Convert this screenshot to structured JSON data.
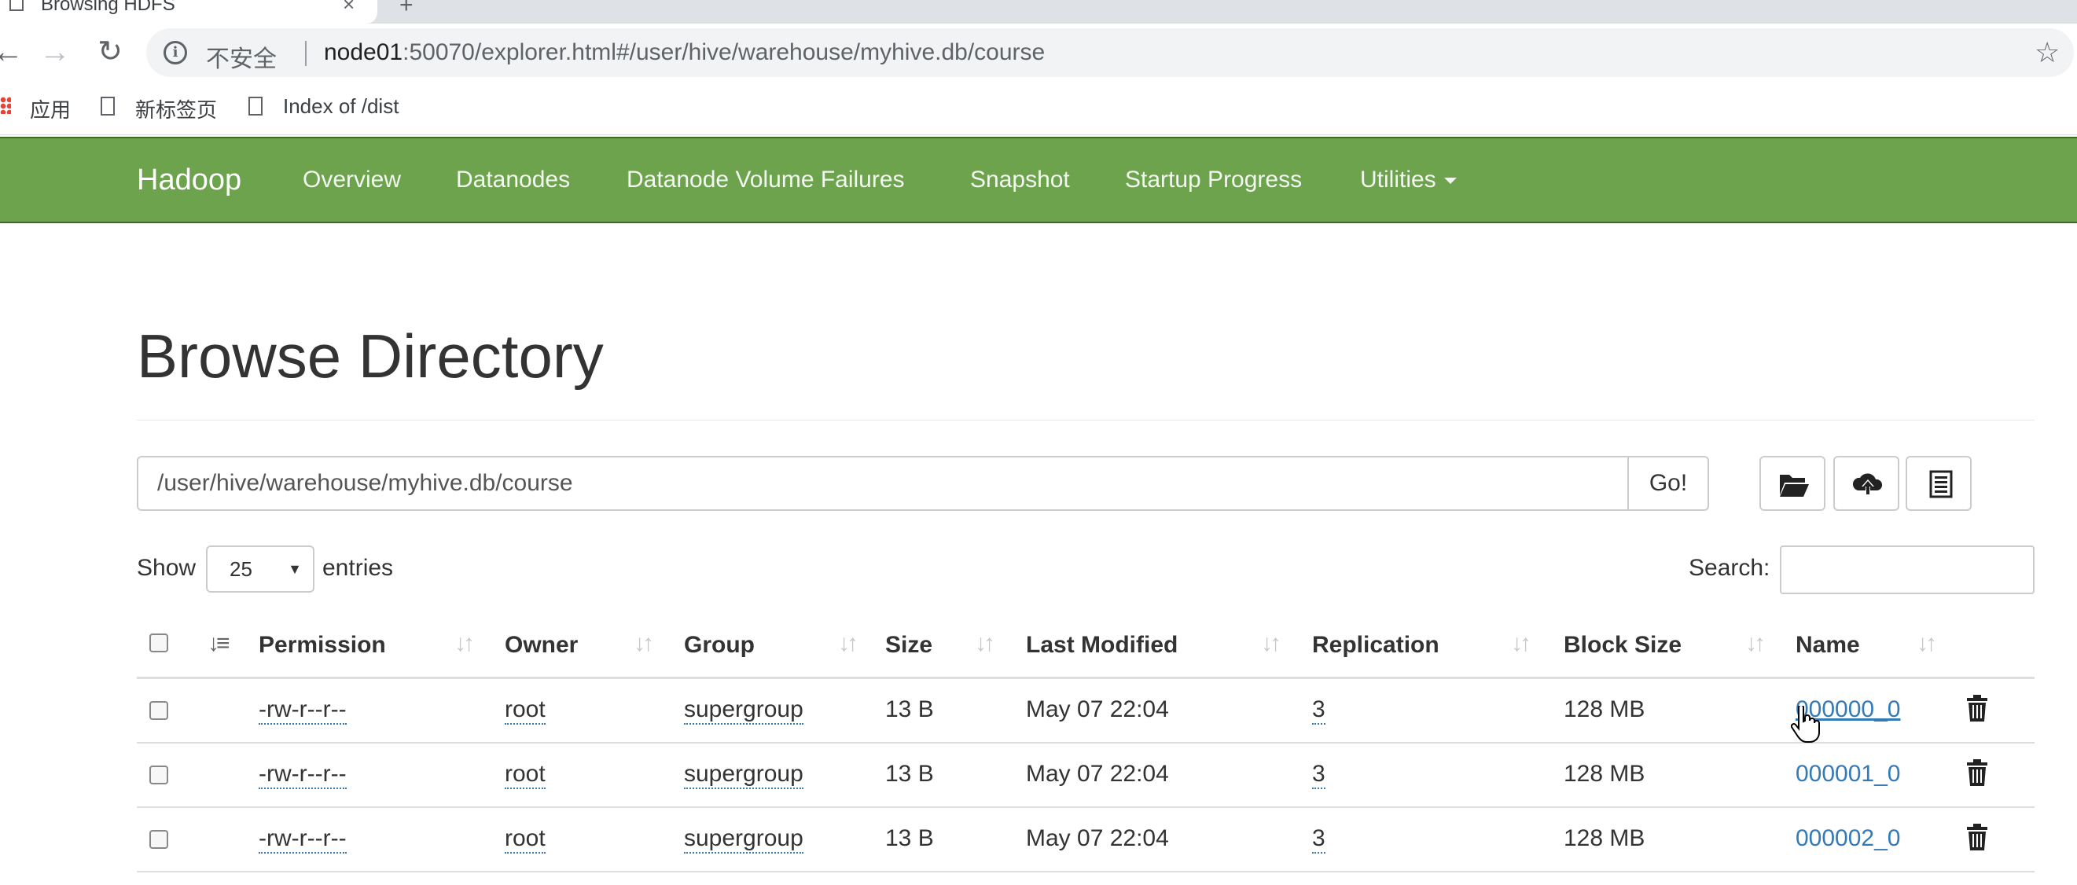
{
  "browser": {
    "tab_title": "Browsing HDFS",
    "insecure_label": "不安全",
    "url_host": "node01",
    "url_rest": ":50070/explorer.html#/user/hive/warehouse/myhive.db/course",
    "bookmarks": [
      {
        "label": "应用"
      },
      {
        "label": "新标签页"
      },
      {
        "label": "Index of /dist"
      }
    ]
  },
  "navbar": {
    "brand": "Hadoop",
    "items": [
      {
        "label": "Overview"
      },
      {
        "label": "Datanodes"
      },
      {
        "label": "Datanode Volume Failures"
      },
      {
        "label": "Snapshot"
      },
      {
        "label": "Startup Progress"
      },
      {
        "label": "Utilities"
      }
    ],
    "color": "#6da34d"
  },
  "page": {
    "title": "Browse Directory",
    "path_value": "/user/hive/warehouse/myhive.db/course",
    "go_label": "Go!",
    "show_label": "Show",
    "entries_value": "25",
    "entries_label": "entries",
    "search_label": "Search:"
  },
  "table": {
    "columns": [
      "Permission",
      "Owner",
      "Group",
      "Size",
      "Last Modified",
      "Replication",
      "Block Size",
      "Name"
    ],
    "rows": [
      {
        "permission": "-rw-r--r--",
        "owner": "root",
        "group": "supergroup",
        "size": "13 B",
        "modified": "May 07 22:04",
        "replication": "3",
        "block_size": "128 MB",
        "name": "000000_0"
      },
      {
        "permission": "-rw-r--r--",
        "owner": "root",
        "group": "supergroup",
        "size": "13 B",
        "modified": "May 07 22:04",
        "replication": "3",
        "block_size": "128 MB",
        "name": "000001_0"
      },
      {
        "permission": "-rw-r--r--",
        "owner": "root",
        "group": "supergroup",
        "size": "13 B",
        "modified": "May 07 22:04",
        "replication": "3",
        "block_size": "128 MB",
        "name": "000002_0"
      }
    ]
  }
}
